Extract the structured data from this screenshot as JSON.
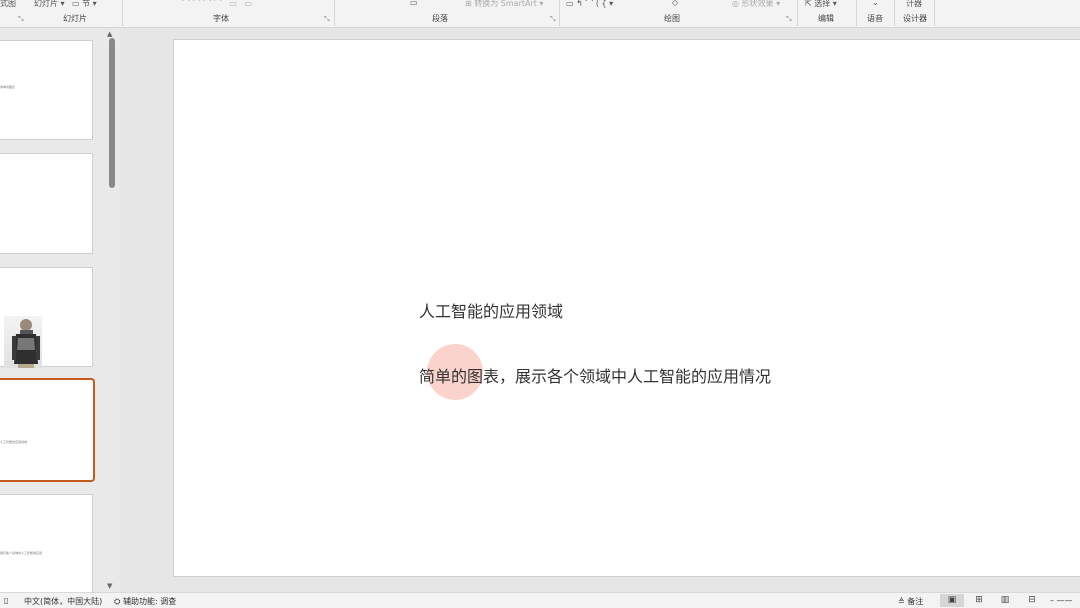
{
  "ribbon": {
    "fragments": {
      "layout_clip": "式图",
      "slide_clip": "幻灯片 ▾",
      "section": "节 ▾",
      "smartart": "转换为 SmartArt ▾",
      "shape_effects": "形状效果 ▾",
      "select": "选择 ▾",
      "designer_clip": "计器"
    },
    "groups": {
      "slides": "幻灯片",
      "font": "字体",
      "paragraph": "段落",
      "drawing": "绘图",
      "editing": "编辑",
      "voice": "语音",
      "designer": "设计器"
    },
    "launcher_glyph": "⤡"
  },
  "thumbnails": [
    {
      "text": "简单的图表"
    },
    {
      "text": ""
    },
    {
      "text": ""
    },
    {
      "text": "人工智能的应用领域"
    },
    {
      "text": "展示各个领域中人工智能的应用"
    }
  ],
  "slide": {
    "title": "人工智能的应用领域",
    "body": "简单的图表，展示各个领域中人工智能的应用情况"
  },
  "status": {
    "language": "中文(简体，中国大陆)",
    "accessibility": "辅助功能: 调查",
    "notes": "备注",
    "zoom_dash": "– ——"
  }
}
